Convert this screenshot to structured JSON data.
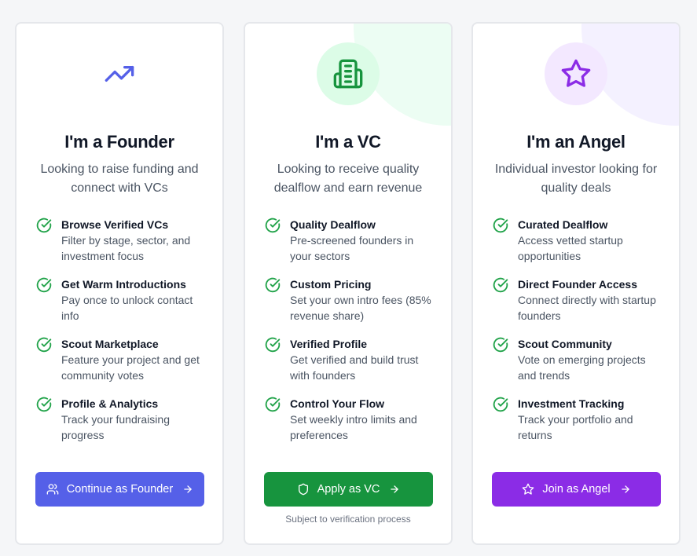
{
  "colors": {
    "founder_accent": "#5560e8",
    "vc_accent": "#17943e",
    "angel_accent": "#8b2ce6",
    "check": "#22a34a"
  },
  "cards": [
    {
      "icon": "trending-up-icon",
      "title": "I'm a Founder",
      "subtitle": "Looking to raise funding and connect with VCs",
      "features": [
        {
          "title": "Browse Verified VCs",
          "desc": "Filter by stage, sector, and investment focus"
        },
        {
          "title": "Get Warm Introductions",
          "desc": "Pay once to unlock contact info"
        },
        {
          "title": "Scout Marketplace",
          "desc": "Feature your project and get community votes"
        },
        {
          "title": "Profile & Analytics",
          "desc": "Track your fundraising progress"
        }
      ],
      "button": {
        "icon": "users-icon",
        "label": "Continue as Founder"
      }
    },
    {
      "icon": "building-icon",
      "title": "I'm a VC",
      "subtitle": "Looking to receive quality dealflow and earn revenue",
      "features": [
        {
          "title": "Quality Dealflow",
          "desc": "Pre-screened founders in your sectors"
        },
        {
          "title": "Custom Pricing",
          "desc": "Set your own intro fees (85% revenue share)"
        },
        {
          "title": "Verified Profile",
          "desc": "Get verified and build trust with founders"
        },
        {
          "title": "Control Your Flow",
          "desc": "Set weekly intro limits and preferences"
        }
      ],
      "button": {
        "icon": "shield-icon",
        "label": "Apply as VC"
      },
      "note": "Subject to verification process"
    },
    {
      "icon": "star-icon",
      "title": "I'm an Angel",
      "subtitle": "Individual investor looking for quality deals",
      "features": [
        {
          "title": "Curated Dealflow",
          "desc": "Access vetted startup opportunities"
        },
        {
          "title": "Direct Founder Access",
          "desc": "Connect directly with startup founders"
        },
        {
          "title": "Scout Community",
          "desc": "Vote on emerging projects and trends"
        },
        {
          "title": "Investment Tracking",
          "desc": "Track your portfolio and returns"
        }
      ],
      "button": {
        "icon": "star-icon",
        "label": "Join as Angel"
      }
    }
  ]
}
